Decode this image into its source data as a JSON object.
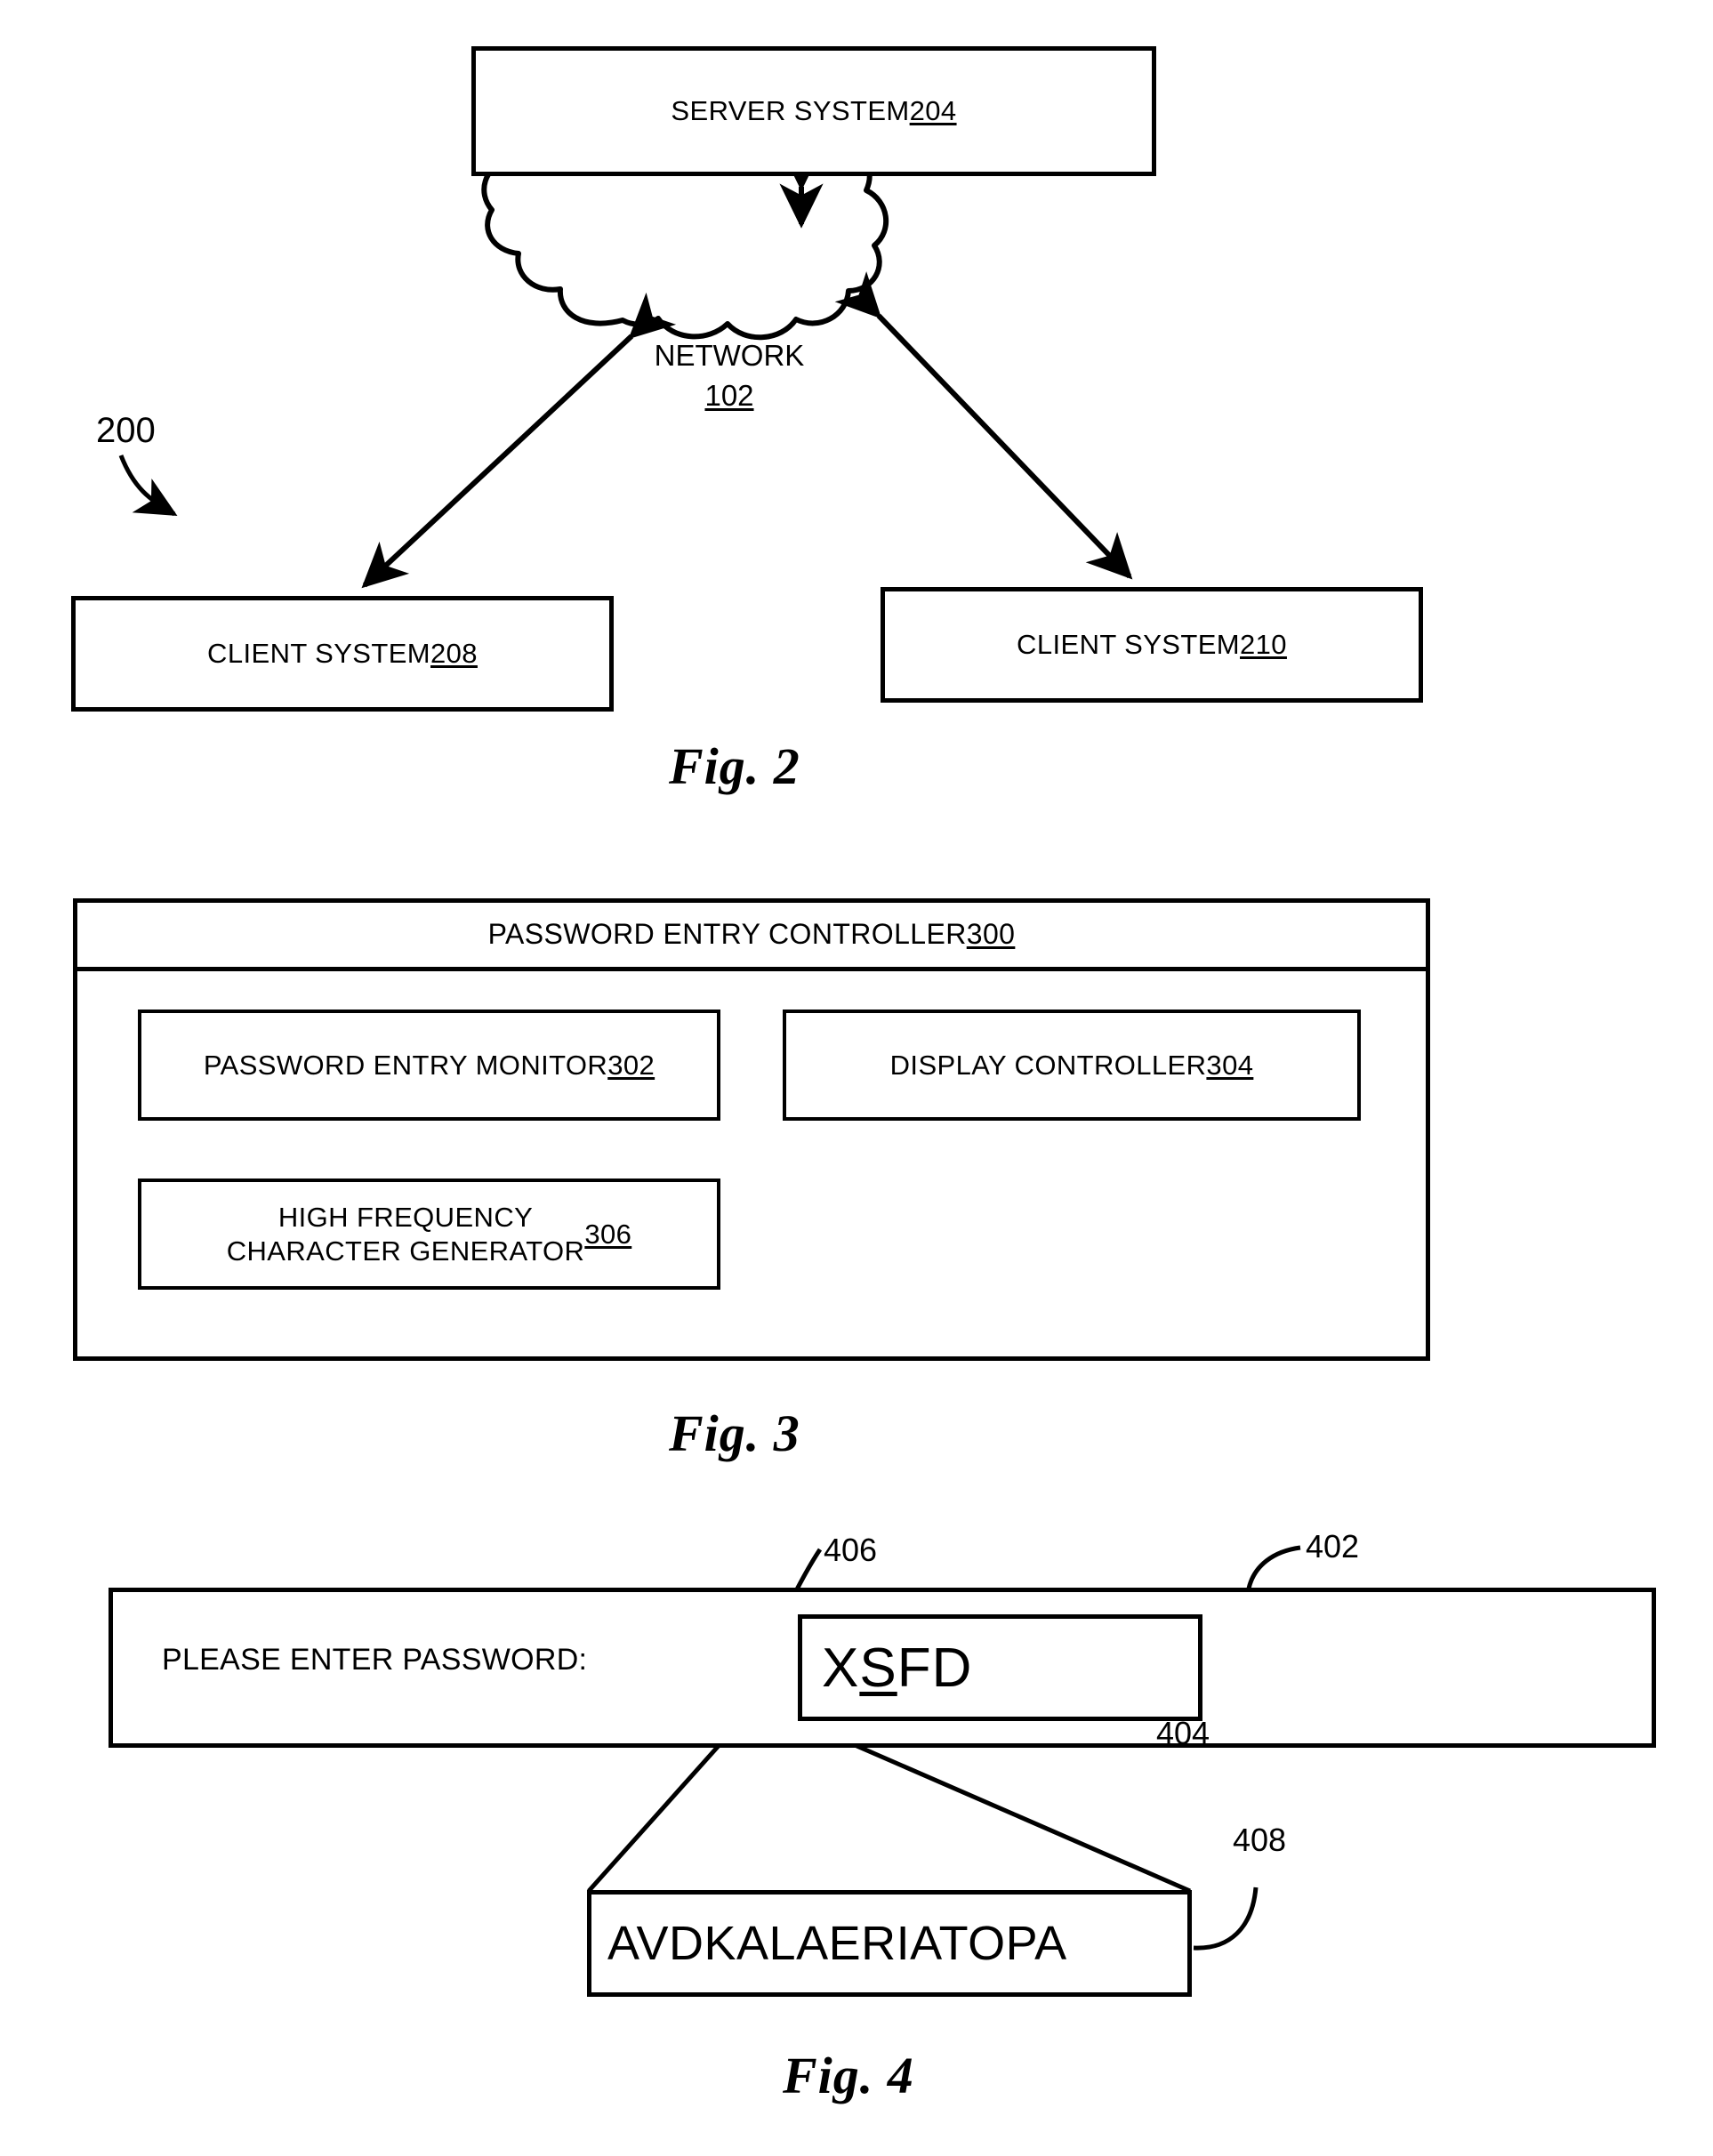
{
  "figures": [
    {
      "id": "fig2",
      "caption": "Fig. 2",
      "system_ref": "200",
      "nodes": {
        "server": {
          "label": "SERVER SYSTEM ",
          "ref": "204"
        },
        "network": {
          "label": "NETWORK",
          "ref": "102"
        },
        "client_left": {
          "label": "CLIENT SYSTEM ",
          "ref": "208"
        },
        "client_right": {
          "label": "CLIENT SYSTEM ",
          "ref": "210"
        }
      }
    },
    {
      "id": "fig3",
      "caption": "Fig. 3",
      "container": {
        "label": "PASSWORD ENTRY CONTROLLER ",
        "ref": "300"
      },
      "modules": [
        {
          "label": "PASSWORD ENTRY MONITOR\n",
          "ref": "302"
        },
        {
          "label": "DISPLAY CONTROLLER ",
          "ref": "304"
        },
        {
          "label": "HIGH FREQUENCY\nCHARACTER GENERATOR ",
          "ref": "306"
        }
      ]
    },
    {
      "id": "fig4",
      "caption": "Fig. 4",
      "panel_ref": "402",
      "field_ref": "404",
      "highlight_ref": "406",
      "magnified_ref": "408",
      "prompt": "PLEASE ENTER PASSWORD:",
      "password_before": "X",
      "password_highlight": "S",
      "password_after": "FD",
      "magnified_value": "AVDKALAERIATOPA"
    }
  ],
  "style": {
    "ink": "#000000",
    "paper": "#ffffff"
  }
}
